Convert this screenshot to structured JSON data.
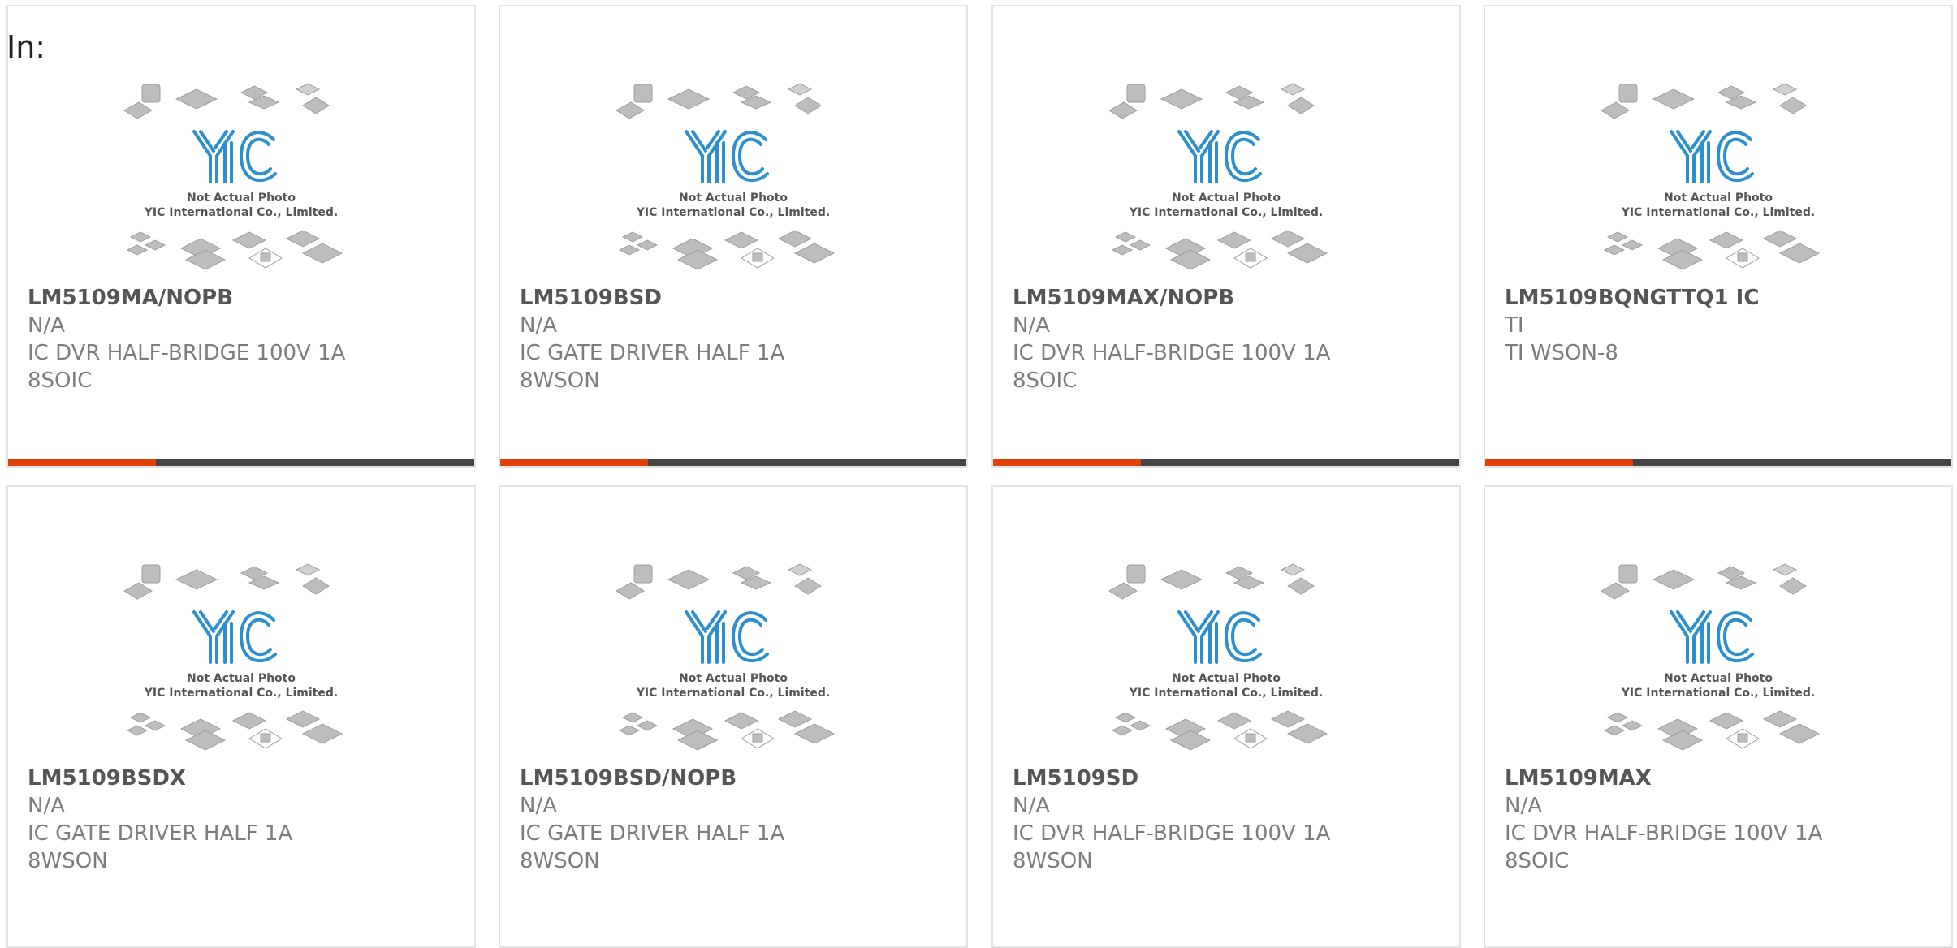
{
  "prefix_label": "In:",
  "placeholder_image": {
    "line1": "Not Actual Photo",
    "line2": "YIC International Co., Limited.",
    "logo": "YIC"
  },
  "colors": {
    "accent": "#e0400a",
    "bar": "#454545",
    "logo_blue": "#2c8fd0"
  },
  "products": [
    {
      "part": "LM5109MA/NOPB",
      "mfr": "N/A",
      "desc": "IC DVR HALF-BRIDGE 100V 1A",
      "pkg": "8SOIC"
    },
    {
      "part": "LM5109BSD",
      "mfr": "N/A",
      "desc": "IC GATE DRIVER HALF 1A",
      "pkg": "8WSON"
    },
    {
      "part": "LM5109MAX/NOPB",
      "mfr": "N/A",
      "desc": "IC DVR HALF-BRIDGE 100V 1A",
      "pkg": "8SOIC"
    },
    {
      "part": "LM5109BQNGTTQ1 IC",
      "mfr": "TI",
      "desc": "TI WSON-8",
      "pkg": ""
    },
    {
      "part": "LM5109BSDX",
      "mfr": "N/A",
      "desc": "IC GATE DRIVER HALF 1A",
      "pkg": "8WSON"
    },
    {
      "part": "LM5109BSD/NOPB",
      "mfr": "N/A",
      "desc": "IC GATE DRIVER HALF 1A",
      "pkg": "8WSON"
    },
    {
      "part": "LM5109SD",
      "mfr": "N/A",
      "desc": "IC DVR HALF-BRIDGE 100V 1A",
      "pkg": "8WSON"
    },
    {
      "part": "LM5109MAX",
      "mfr": "N/A",
      "desc": "IC DVR HALF-BRIDGE 100V 1A",
      "pkg": "8SOIC"
    }
  ]
}
